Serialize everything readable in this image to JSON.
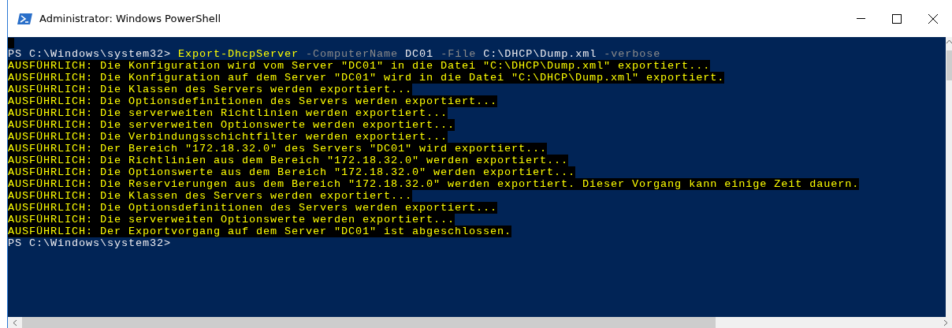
{
  "window": {
    "title": "Administrator: Windows PowerShell"
  },
  "console": {
    "lines": [
      {
        "kind": "prompt",
        "segments": [
          {
            "kind": "prompt",
            "text": "PS C:\\Windows\\system32> "
          },
          {
            "kind": "command",
            "text": "Export-DhcpServer"
          },
          {
            "kind": "parameter",
            "text": " -ComputerName"
          },
          {
            "kind": "argument",
            "text": " DC01"
          },
          {
            "kind": "parameter",
            "text": " -File"
          },
          {
            "kind": "argument",
            "text": " C:\\DHCP\\Dump.xml"
          },
          {
            "kind": "parameter",
            "text": " -verbose"
          }
        ]
      },
      {
        "kind": "verbose",
        "text": "AUSFÜHRLICH: Die Konfiguration wird vom Server \"DC01\" in die Datei \"C:\\DHCP\\Dump.xml\" exportiert..."
      },
      {
        "kind": "verbose",
        "text": "AUSFÜHRLICH: Die Konfiguration auf dem Server \"DC01\" wird in die Datei \"C:\\DHCP\\Dump.xml\" exportiert."
      },
      {
        "kind": "verbose",
        "text": "AUSFÜHRLICH: Die Klassen des Servers werden exportiert..."
      },
      {
        "kind": "verbose",
        "text": "AUSFÜHRLICH: Die Optionsdefinitionen des Servers werden exportiert..."
      },
      {
        "kind": "verbose",
        "text": "AUSFÜHRLICH: Die serverweiten Richtlinien werden exportiert..."
      },
      {
        "kind": "verbose",
        "text": "AUSFÜHRLICH: Die serverweiten Optionswerte werden exportiert..."
      },
      {
        "kind": "verbose",
        "text": "AUSFÜHRLICH: Die Verbindungsschichtfilter werden exportiert..."
      },
      {
        "kind": "verbose",
        "text": "AUSFÜHRLICH: Der Bereich \"172.18.32.0\" des Servers \"DC01\" wird exportiert..."
      },
      {
        "kind": "verbose",
        "text": "AUSFÜHRLICH: Die Richtlinien aus dem Bereich \"172.18.32.0\" werden exportiert..."
      },
      {
        "kind": "verbose",
        "text": "AUSFÜHRLICH: Die Optionswerte aus dem Bereich \"172.18.32.0\" werden exportiert..."
      },
      {
        "kind": "verbose",
        "text": "AUSFÜHRLICH: Die Reservierungen aus dem Bereich \"172.18.32.0\" werden exportiert. Dieser Vorgang kann einige Zeit dauern."
      },
      {
        "kind": "verbose",
        "text": "AUSFÜHRLICH: Die Klassen des Servers werden exportiert..."
      },
      {
        "kind": "verbose",
        "text": "AUSFÜHRLICH: Die Optionsdefinitionen des Servers werden exportiert..."
      },
      {
        "kind": "verbose",
        "text": "AUSFÜHRLICH: Die serverweiten Optionswerte werden exportiert..."
      },
      {
        "kind": "verbose",
        "text": "AUSFÜHRLICH: Der Exportvorgang auf dem Server \"DC01\" ist abgeschlossen."
      },
      {
        "kind": "prompt",
        "segments": [
          {
            "kind": "prompt",
            "text": "PS C:\\Windows\\system32>"
          }
        ]
      }
    ]
  }
}
